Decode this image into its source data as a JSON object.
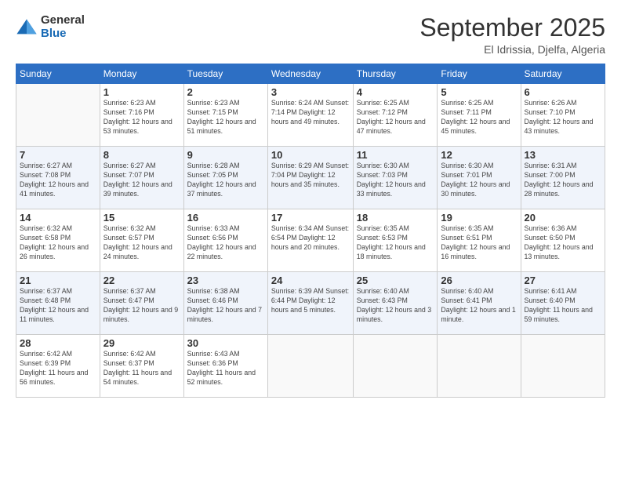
{
  "logo": {
    "general": "General",
    "blue": "Blue"
  },
  "header": {
    "month_year": "September 2025",
    "location": "El Idrissia, Djelfa, Algeria"
  },
  "days_of_week": [
    "Sunday",
    "Monday",
    "Tuesday",
    "Wednesday",
    "Thursday",
    "Friday",
    "Saturday"
  ],
  "weeks": [
    [
      {
        "day": "",
        "info": ""
      },
      {
        "day": "1",
        "info": "Sunrise: 6:23 AM\nSunset: 7:16 PM\nDaylight: 12 hours\nand 53 minutes."
      },
      {
        "day": "2",
        "info": "Sunrise: 6:23 AM\nSunset: 7:15 PM\nDaylight: 12 hours\nand 51 minutes."
      },
      {
        "day": "3",
        "info": "Sunrise: 6:24 AM\nSunset: 7:14 PM\nDaylight: 12 hours\nand 49 minutes."
      },
      {
        "day": "4",
        "info": "Sunrise: 6:25 AM\nSunset: 7:12 PM\nDaylight: 12 hours\nand 47 minutes."
      },
      {
        "day": "5",
        "info": "Sunrise: 6:25 AM\nSunset: 7:11 PM\nDaylight: 12 hours\nand 45 minutes."
      },
      {
        "day": "6",
        "info": "Sunrise: 6:26 AM\nSunset: 7:10 PM\nDaylight: 12 hours\nand 43 minutes."
      }
    ],
    [
      {
        "day": "7",
        "info": "Sunrise: 6:27 AM\nSunset: 7:08 PM\nDaylight: 12 hours\nand 41 minutes."
      },
      {
        "day": "8",
        "info": "Sunrise: 6:27 AM\nSunset: 7:07 PM\nDaylight: 12 hours\nand 39 minutes."
      },
      {
        "day": "9",
        "info": "Sunrise: 6:28 AM\nSunset: 7:05 PM\nDaylight: 12 hours\nand 37 minutes."
      },
      {
        "day": "10",
        "info": "Sunrise: 6:29 AM\nSunset: 7:04 PM\nDaylight: 12 hours\nand 35 minutes."
      },
      {
        "day": "11",
        "info": "Sunrise: 6:30 AM\nSunset: 7:03 PM\nDaylight: 12 hours\nand 33 minutes."
      },
      {
        "day": "12",
        "info": "Sunrise: 6:30 AM\nSunset: 7:01 PM\nDaylight: 12 hours\nand 30 minutes."
      },
      {
        "day": "13",
        "info": "Sunrise: 6:31 AM\nSunset: 7:00 PM\nDaylight: 12 hours\nand 28 minutes."
      }
    ],
    [
      {
        "day": "14",
        "info": "Sunrise: 6:32 AM\nSunset: 6:58 PM\nDaylight: 12 hours\nand 26 minutes."
      },
      {
        "day": "15",
        "info": "Sunrise: 6:32 AM\nSunset: 6:57 PM\nDaylight: 12 hours\nand 24 minutes."
      },
      {
        "day": "16",
        "info": "Sunrise: 6:33 AM\nSunset: 6:56 PM\nDaylight: 12 hours\nand 22 minutes."
      },
      {
        "day": "17",
        "info": "Sunrise: 6:34 AM\nSunset: 6:54 PM\nDaylight: 12 hours\nand 20 minutes."
      },
      {
        "day": "18",
        "info": "Sunrise: 6:35 AM\nSunset: 6:53 PM\nDaylight: 12 hours\nand 18 minutes."
      },
      {
        "day": "19",
        "info": "Sunrise: 6:35 AM\nSunset: 6:51 PM\nDaylight: 12 hours\nand 16 minutes."
      },
      {
        "day": "20",
        "info": "Sunrise: 6:36 AM\nSunset: 6:50 PM\nDaylight: 12 hours\nand 13 minutes."
      }
    ],
    [
      {
        "day": "21",
        "info": "Sunrise: 6:37 AM\nSunset: 6:48 PM\nDaylight: 12 hours\nand 11 minutes."
      },
      {
        "day": "22",
        "info": "Sunrise: 6:37 AM\nSunset: 6:47 PM\nDaylight: 12 hours\nand 9 minutes."
      },
      {
        "day": "23",
        "info": "Sunrise: 6:38 AM\nSunset: 6:46 PM\nDaylight: 12 hours\nand 7 minutes."
      },
      {
        "day": "24",
        "info": "Sunrise: 6:39 AM\nSunset: 6:44 PM\nDaylight: 12 hours\nand 5 minutes."
      },
      {
        "day": "25",
        "info": "Sunrise: 6:40 AM\nSunset: 6:43 PM\nDaylight: 12 hours\nand 3 minutes."
      },
      {
        "day": "26",
        "info": "Sunrise: 6:40 AM\nSunset: 6:41 PM\nDaylight: 12 hours\nand 1 minute."
      },
      {
        "day": "27",
        "info": "Sunrise: 6:41 AM\nSunset: 6:40 PM\nDaylight: 11 hours\nand 59 minutes."
      }
    ],
    [
      {
        "day": "28",
        "info": "Sunrise: 6:42 AM\nSunset: 6:39 PM\nDaylight: 11 hours\nand 56 minutes."
      },
      {
        "day": "29",
        "info": "Sunrise: 6:42 AM\nSunset: 6:37 PM\nDaylight: 11 hours\nand 54 minutes."
      },
      {
        "day": "30",
        "info": "Sunrise: 6:43 AM\nSunset: 6:36 PM\nDaylight: 11 hours\nand 52 minutes."
      },
      {
        "day": "",
        "info": ""
      },
      {
        "day": "",
        "info": ""
      },
      {
        "day": "",
        "info": ""
      },
      {
        "day": "",
        "info": ""
      }
    ]
  ]
}
